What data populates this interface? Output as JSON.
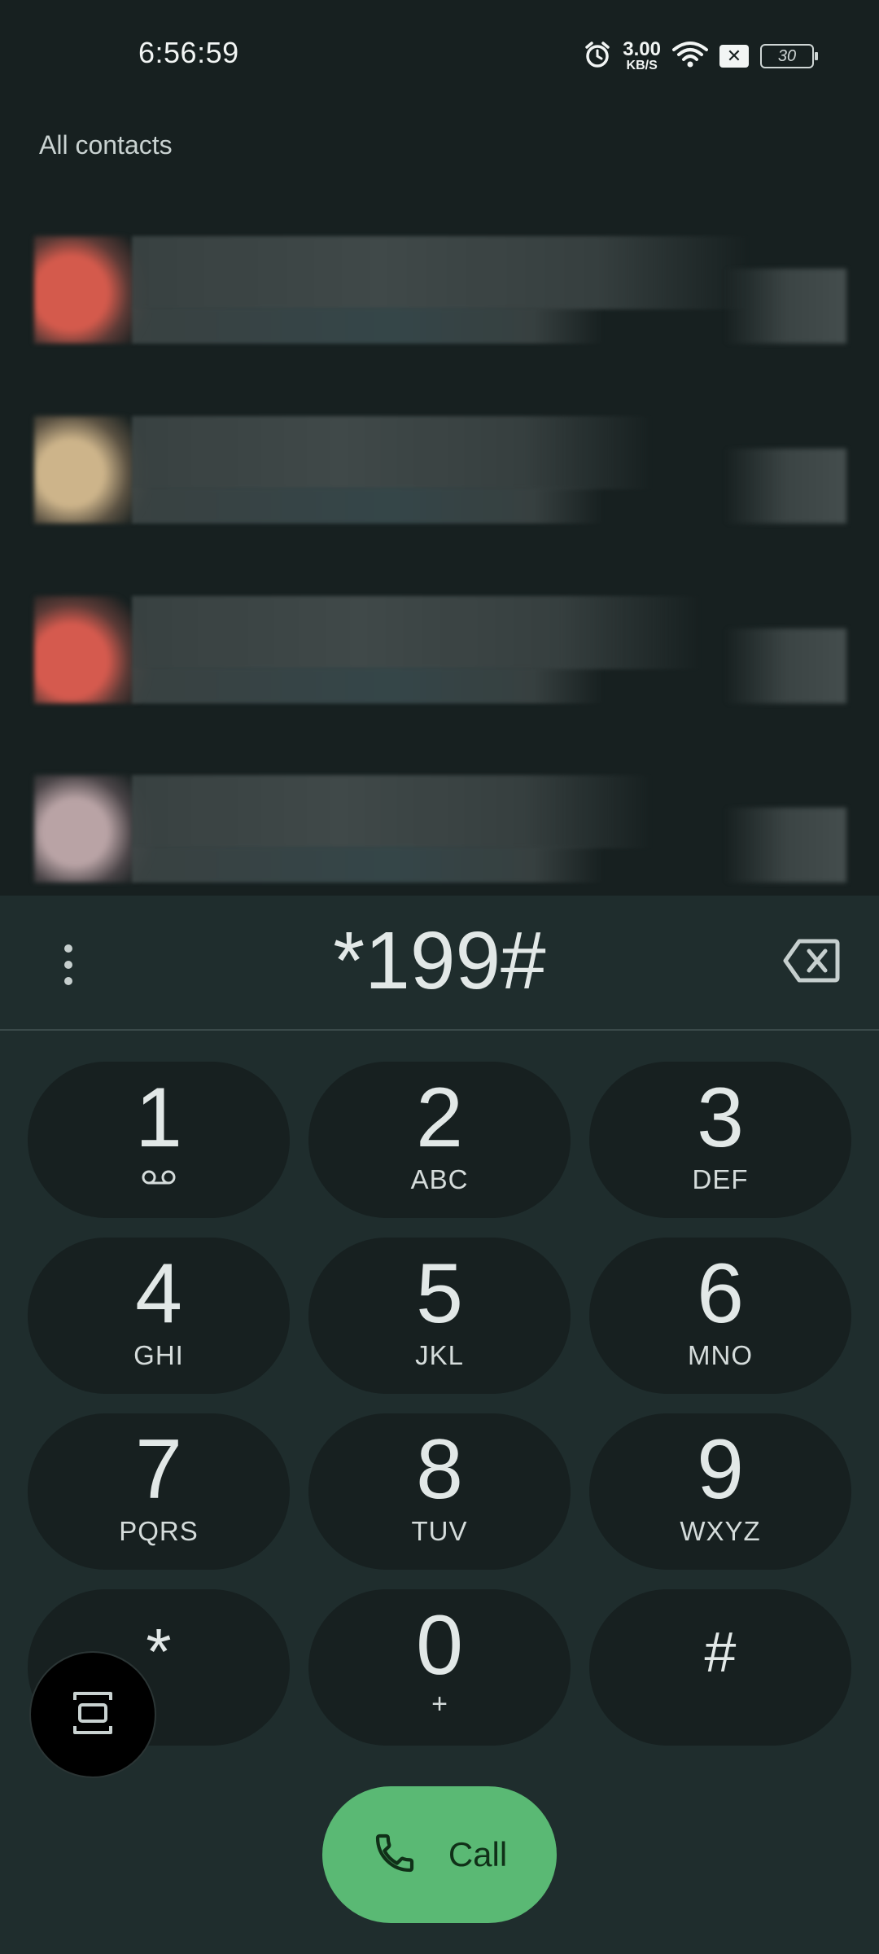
{
  "status_bar": {
    "time": "6:56:59",
    "net_speed_value": "3.00",
    "net_speed_unit": "KB/S",
    "battery_level": "30"
  },
  "contacts": {
    "section_title": "All contacts",
    "rows": [
      {
        "avatar_color": "#d45a4c"
      },
      {
        "avatar_color": "#cdb48a"
      },
      {
        "avatar_color": "#d55a4e"
      },
      {
        "avatar_color": "#b9a3a5"
      }
    ]
  },
  "dialpad": {
    "entered_digits": "*199#",
    "keys": [
      {
        "num": "1",
        "letters": ""
      },
      {
        "num": "2",
        "letters": "ABC"
      },
      {
        "num": "3",
        "letters": "DEF"
      },
      {
        "num": "4",
        "letters": "GHI"
      },
      {
        "num": "5",
        "letters": "JKL"
      },
      {
        "num": "6",
        "letters": "MNO"
      },
      {
        "num": "7",
        "letters": "PQRS"
      },
      {
        "num": "8",
        "letters": "TUV"
      },
      {
        "num": "9",
        "letters": "WXYZ"
      },
      {
        "num": "*",
        "letters": ""
      },
      {
        "num": "0",
        "letters": "+"
      },
      {
        "num": "#",
        "letters": ""
      }
    ],
    "call_label": "Call"
  },
  "colors": {
    "background": "#172020",
    "sheet": "#1f2d2d",
    "key": "#172020",
    "call_accent": "#5ab974"
  },
  "icons": {
    "alarm": "alarm-icon",
    "wifi": "wifi-icon",
    "notification": "close-box-icon",
    "voicemail": "voicemail-icon",
    "backspace": "backspace-icon",
    "more": "more-vert-icon",
    "phone": "phone-icon",
    "floating": "screen-capture-icon"
  }
}
